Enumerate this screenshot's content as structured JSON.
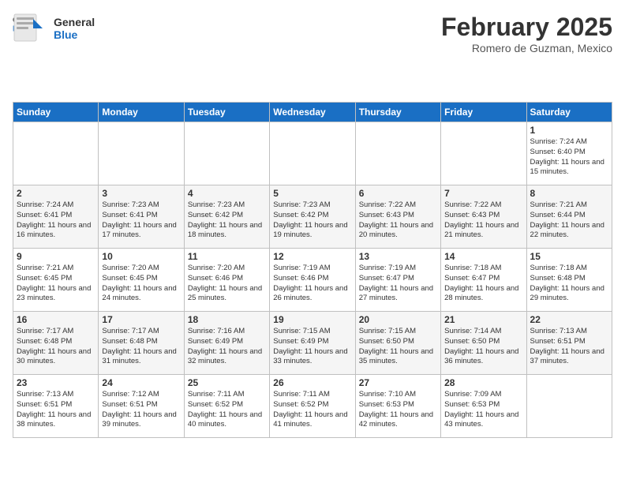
{
  "logo": {
    "line1": "General",
    "line2": "Blue"
  },
  "calendar": {
    "title": "February 2025",
    "subtitle": "Romero de Guzman, Mexico"
  },
  "days_of_week": [
    "Sunday",
    "Monday",
    "Tuesday",
    "Wednesday",
    "Thursday",
    "Friday",
    "Saturday"
  ],
  "weeks": [
    [
      {
        "day": "",
        "info": ""
      },
      {
        "day": "",
        "info": ""
      },
      {
        "day": "",
        "info": ""
      },
      {
        "day": "",
        "info": ""
      },
      {
        "day": "",
        "info": ""
      },
      {
        "day": "",
        "info": ""
      },
      {
        "day": "1",
        "info": "Sunrise: 7:24 AM\nSunset: 6:40 PM\nDaylight: 11 hours and 15 minutes."
      }
    ],
    [
      {
        "day": "2",
        "info": "Sunrise: 7:24 AM\nSunset: 6:41 PM\nDaylight: 11 hours and 16 minutes."
      },
      {
        "day": "3",
        "info": "Sunrise: 7:23 AM\nSunset: 6:41 PM\nDaylight: 11 hours and 17 minutes."
      },
      {
        "day": "4",
        "info": "Sunrise: 7:23 AM\nSunset: 6:42 PM\nDaylight: 11 hours and 18 minutes."
      },
      {
        "day": "5",
        "info": "Sunrise: 7:23 AM\nSunset: 6:42 PM\nDaylight: 11 hours and 19 minutes."
      },
      {
        "day": "6",
        "info": "Sunrise: 7:22 AM\nSunset: 6:43 PM\nDaylight: 11 hours and 20 minutes."
      },
      {
        "day": "7",
        "info": "Sunrise: 7:22 AM\nSunset: 6:43 PM\nDaylight: 11 hours and 21 minutes."
      },
      {
        "day": "8",
        "info": "Sunrise: 7:21 AM\nSunset: 6:44 PM\nDaylight: 11 hours and 22 minutes."
      }
    ],
    [
      {
        "day": "9",
        "info": "Sunrise: 7:21 AM\nSunset: 6:45 PM\nDaylight: 11 hours and 23 minutes."
      },
      {
        "day": "10",
        "info": "Sunrise: 7:20 AM\nSunset: 6:45 PM\nDaylight: 11 hours and 24 minutes."
      },
      {
        "day": "11",
        "info": "Sunrise: 7:20 AM\nSunset: 6:46 PM\nDaylight: 11 hours and 25 minutes."
      },
      {
        "day": "12",
        "info": "Sunrise: 7:19 AM\nSunset: 6:46 PM\nDaylight: 11 hours and 26 minutes."
      },
      {
        "day": "13",
        "info": "Sunrise: 7:19 AM\nSunset: 6:47 PM\nDaylight: 11 hours and 27 minutes."
      },
      {
        "day": "14",
        "info": "Sunrise: 7:18 AM\nSunset: 6:47 PM\nDaylight: 11 hours and 28 minutes."
      },
      {
        "day": "15",
        "info": "Sunrise: 7:18 AM\nSunset: 6:48 PM\nDaylight: 11 hours and 29 minutes."
      }
    ],
    [
      {
        "day": "16",
        "info": "Sunrise: 7:17 AM\nSunset: 6:48 PM\nDaylight: 11 hours and 30 minutes."
      },
      {
        "day": "17",
        "info": "Sunrise: 7:17 AM\nSunset: 6:48 PM\nDaylight: 11 hours and 31 minutes."
      },
      {
        "day": "18",
        "info": "Sunrise: 7:16 AM\nSunset: 6:49 PM\nDaylight: 11 hours and 32 minutes."
      },
      {
        "day": "19",
        "info": "Sunrise: 7:15 AM\nSunset: 6:49 PM\nDaylight: 11 hours and 33 minutes."
      },
      {
        "day": "20",
        "info": "Sunrise: 7:15 AM\nSunset: 6:50 PM\nDaylight: 11 hours and 35 minutes."
      },
      {
        "day": "21",
        "info": "Sunrise: 7:14 AM\nSunset: 6:50 PM\nDaylight: 11 hours and 36 minutes."
      },
      {
        "day": "22",
        "info": "Sunrise: 7:13 AM\nSunset: 6:51 PM\nDaylight: 11 hours and 37 minutes."
      }
    ],
    [
      {
        "day": "23",
        "info": "Sunrise: 7:13 AM\nSunset: 6:51 PM\nDaylight: 11 hours and 38 minutes."
      },
      {
        "day": "24",
        "info": "Sunrise: 7:12 AM\nSunset: 6:51 PM\nDaylight: 11 hours and 39 minutes."
      },
      {
        "day": "25",
        "info": "Sunrise: 7:11 AM\nSunset: 6:52 PM\nDaylight: 11 hours and 40 minutes."
      },
      {
        "day": "26",
        "info": "Sunrise: 7:11 AM\nSunset: 6:52 PM\nDaylight: 11 hours and 41 minutes."
      },
      {
        "day": "27",
        "info": "Sunrise: 7:10 AM\nSunset: 6:53 PM\nDaylight: 11 hours and 42 minutes."
      },
      {
        "day": "28",
        "info": "Sunrise: 7:09 AM\nSunset: 6:53 PM\nDaylight: 11 hours and 43 minutes."
      },
      {
        "day": "",
        "info": ""
      }
    ]
  ]
}
